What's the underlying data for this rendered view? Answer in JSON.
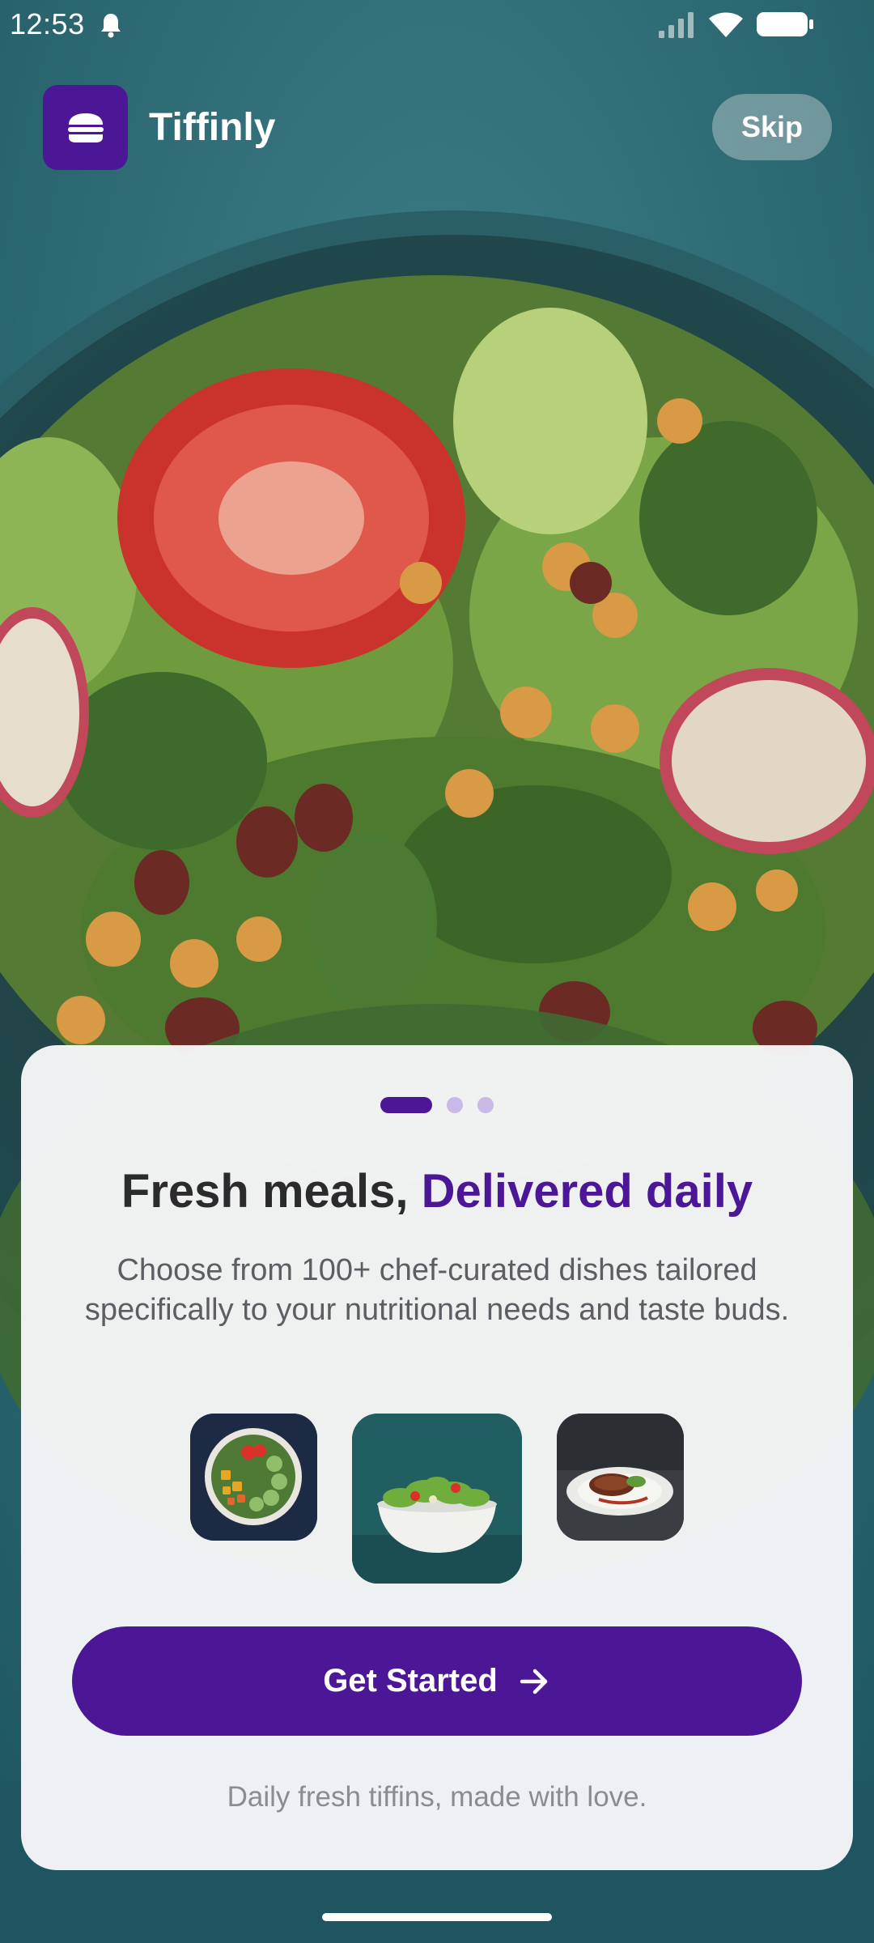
{
  "status_bar": {
    "time": "12:53",
    "icons": [
      "bell-icon",
      "signal-icon",
      "wifi-icon",
      "battery-icon"
    ]
  },
  "header": {
    "app_name": "Tiffinly",
    "logo_icon": "burger-icon",
    "skip_label": "Skip"
  },
  "onboarding": {
    "page_index": 1,
    "page_count": 3,
    "title_plain": "Fresh meals, ",
    "title_accent": "Delivered daily",
    "description": "Choose from 100+ chef-curated dishes tailored specifically to your nutritional needs and taste buds.",
    "thumbnails": [
      "veggie-bowl-image",
      "salad-bowl-image",
      "steak-plate-image"
    ],
    "cta_label": "Get Started",
    "cta_icon": "arrow-right-icon",
    "tagline": "Daily fresh tiffins, made with love."
  },
  "colors": {
    "brand_purple": "#4c1796",
    "pager_inactive": "#c9b9e6",
    "background_teal": "#2a6672"
  }
}
